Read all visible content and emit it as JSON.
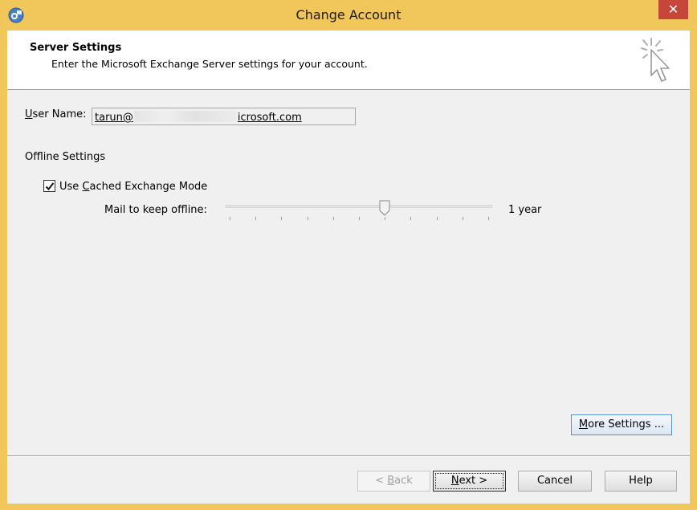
{
  "window": {
    "title": "Change Account",
    "close_glyph": "✕"
  },
  "header": {
    "title": "Server Settings",
    "subtitle": "Enter the Microsoft Exchange Server settings for your account."
  },
  "form": {
    "username_label_first": "U",
    "username_label_rest": "ser Name:",
    "username_value_start": "tarun@",
    "username_value_end": "icrosoft.com",
    "offline_heading": "Offline Settings",
    "cached_mode_checked": true,
    "cached_mode_label_prefix": "Use ",
    "cached_mode_label_accel": "C",
    "cached_mode_label_rest": "ached Exchange Mode",
    "mail_offline_label": "Mail to keep offline:",
    "mail_offline_value": "1 year",
    "slider_position_fraction": 0.6
  },
  "buttons": {
    "more_settings_accel": "M",
    "more_settings_rest": "ore Settings ...",
    "back_prefix": "< ",
    "back_accel": "B",
    "back_rest": "ack",
    "next_accel": "N",
    "next_rest": "ext >",
    "cancel": "Cancel",
    "help": "Help"
  },
  "colors": {
    "frame": "#f1c75c",
    "close_button": "#c6463a",
    "client_bg": "#f0f0f0"
  },
  "icons": [
    "outlook-app-icon",
    "wizard-cursor-icon",
    "check-icon"
  ]
}
